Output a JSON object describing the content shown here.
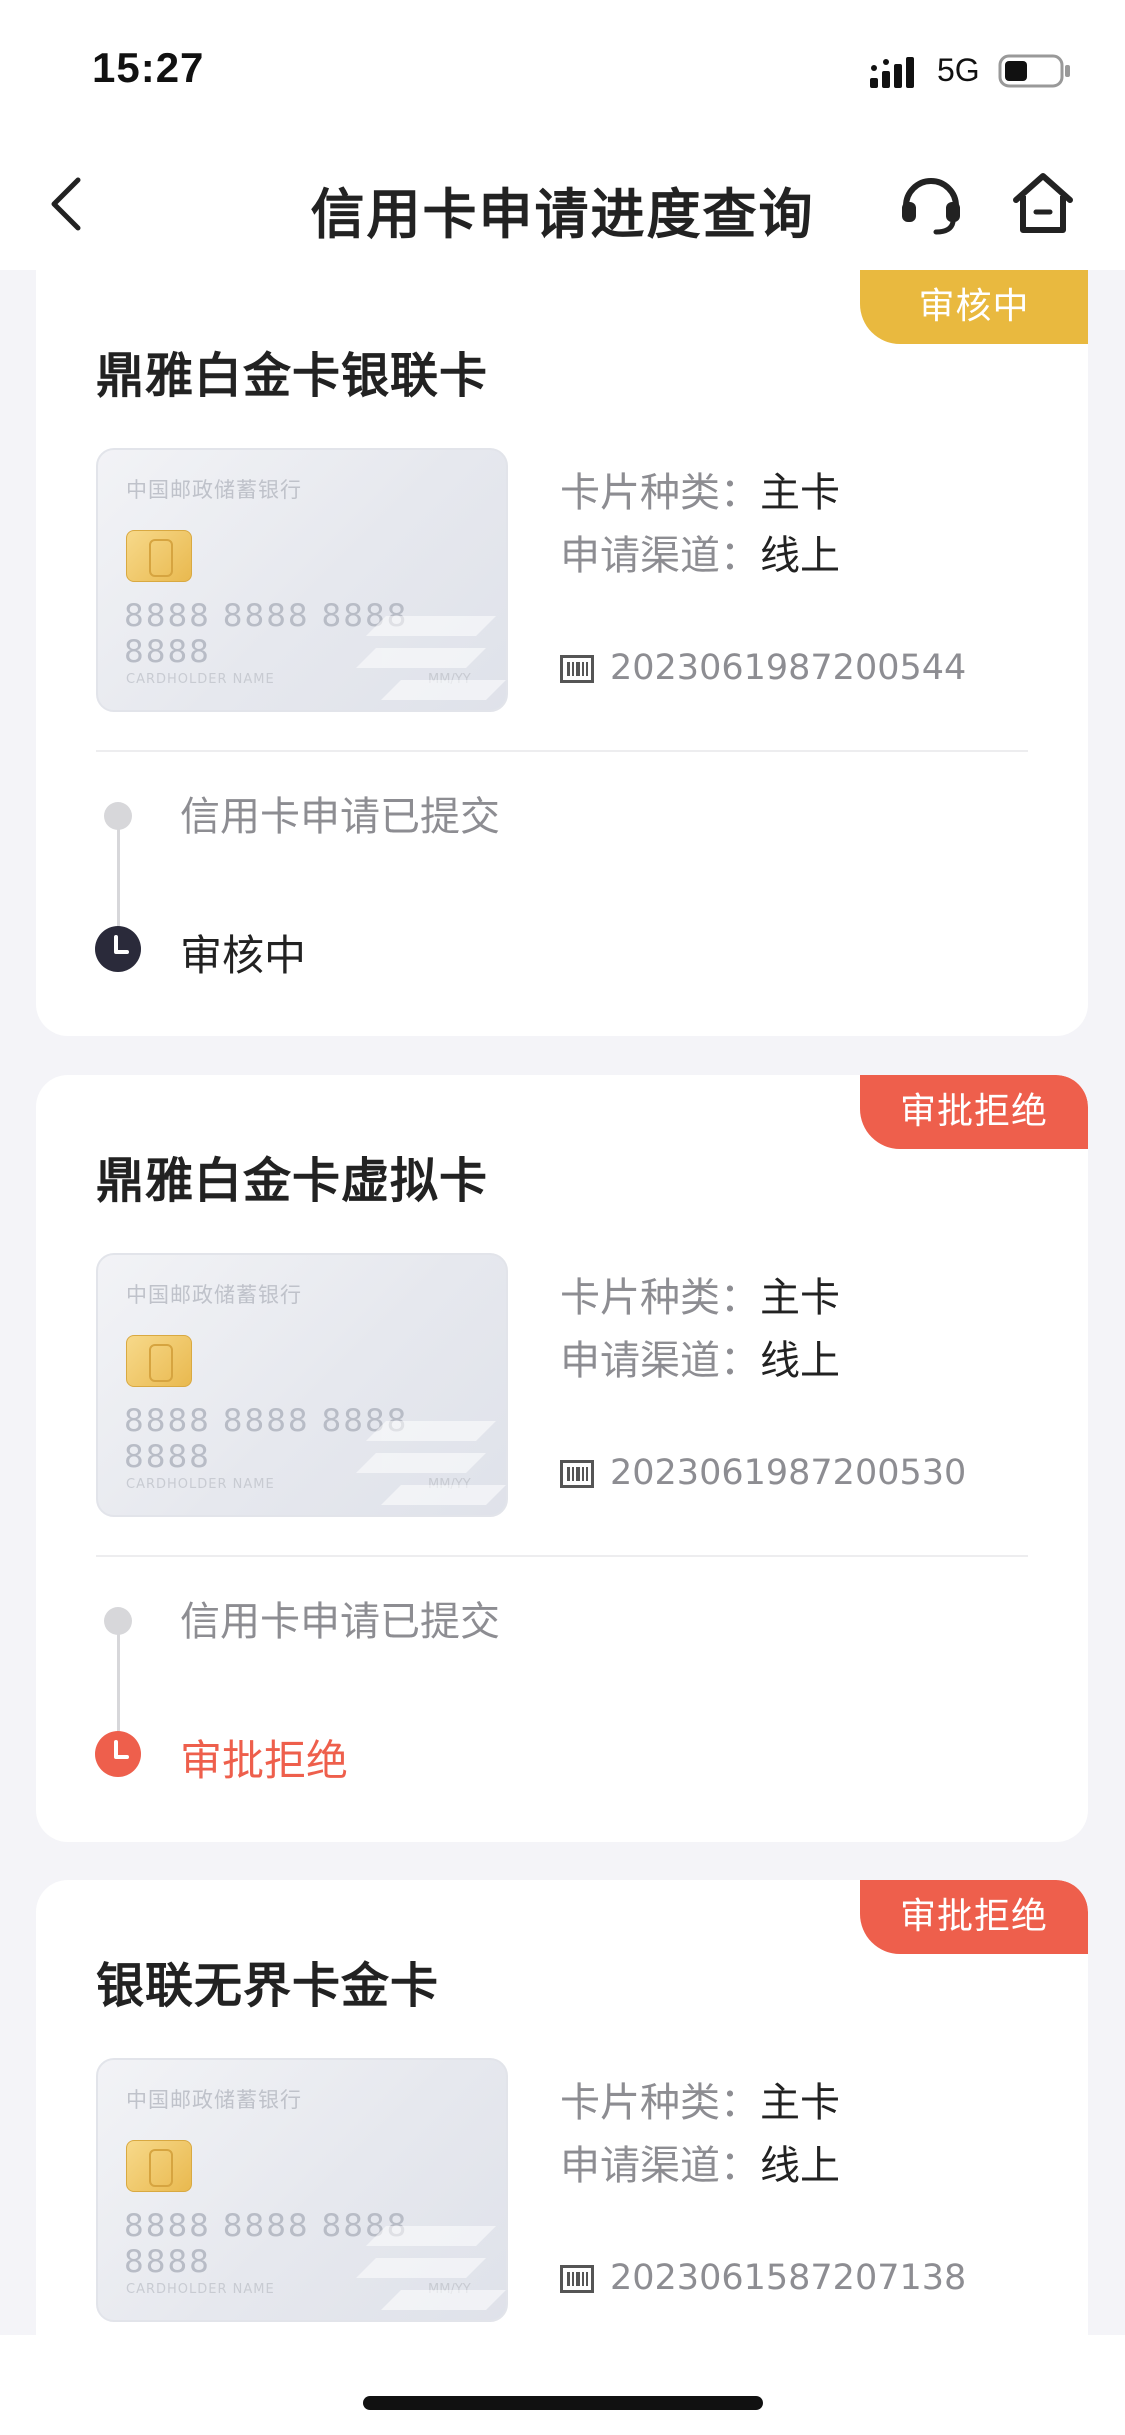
{
  "status_bar": {
    "time": "15:27",
    "network": "5G",
    "signal_icon": "signal-bars-icon",
    "battery_icon": "battery-icon",
    "battery_level": 0.4
  },
  "nav": {
    "title": "信用卡申请进度查询",
    "back_icon": "back-chevron-icon",
    "service_icon": "headset-icon",
    "home_icon": "home-icon"
  },
  "colors": {
    "reviewing": "#e9b93f",
    "rejected": "#ee5f4c",
    "label_grey": "#8d8d92",
    "text_dark": "#222222"
  },
  "applications": [
    {
      "status": "审核中",
      "card_name": "鼎雅白金卡银联卡",
      "card_image": {
        "bank_name": "中国邮政储蓄银行",
        "number": "8888 8888 8888 8888",
        "holder": "CARDHOLDER NAME",
        "expiry": "MM/YY"
      },
      "card_type_label": "卡片种类：",
      "card_type_value": "主卡",
      "channel_label": "申请渠道：",
      "channel_value": "线上",
      "application_no": "2023061987200544",
      "steps": [
        "信用卡申请已提交",
        "审核中"
      ]
    },
    {
      "status": "审批拒绝",
      "card_name": "鼎雅白金卡虚拟卡",
      "card_image": {
        "bank_name": "中国邮政储蓄银行",
        "number": "8888 8888 8888 8888",
        "holder": "CARDHOLDER NAME",
        "expiry": "MM/YY"
      },
      "card_type_label": "卡片种类：",
      "card_type_value": "主卡",
      "channel_label": "申请渠道：",
      "channel_value": "线上",
      "application_no": "2023061987200530",
      "steps": [
        "信用卡申请已提交",
        "审批拒绝"
      ]
    },
    {
      "status": "审批拒绝",
      "card_name": "银联无界卡金卡",
      "card_image": {
        "bank_name": "中国邮政储蓄银行",
        "number": "8888 8888 8888 8888",
        "holder": "CARDHOLDER NAME",
        "expiry": "MM/YY"
      },
      "card_type_label": "卡片种类：",
      "card_type_value": "主卡",
      "channel_label": "申请渠道：",
      "channel_value": "线上",
      "application_no": "2023061587207138"
    }
  ]
}
